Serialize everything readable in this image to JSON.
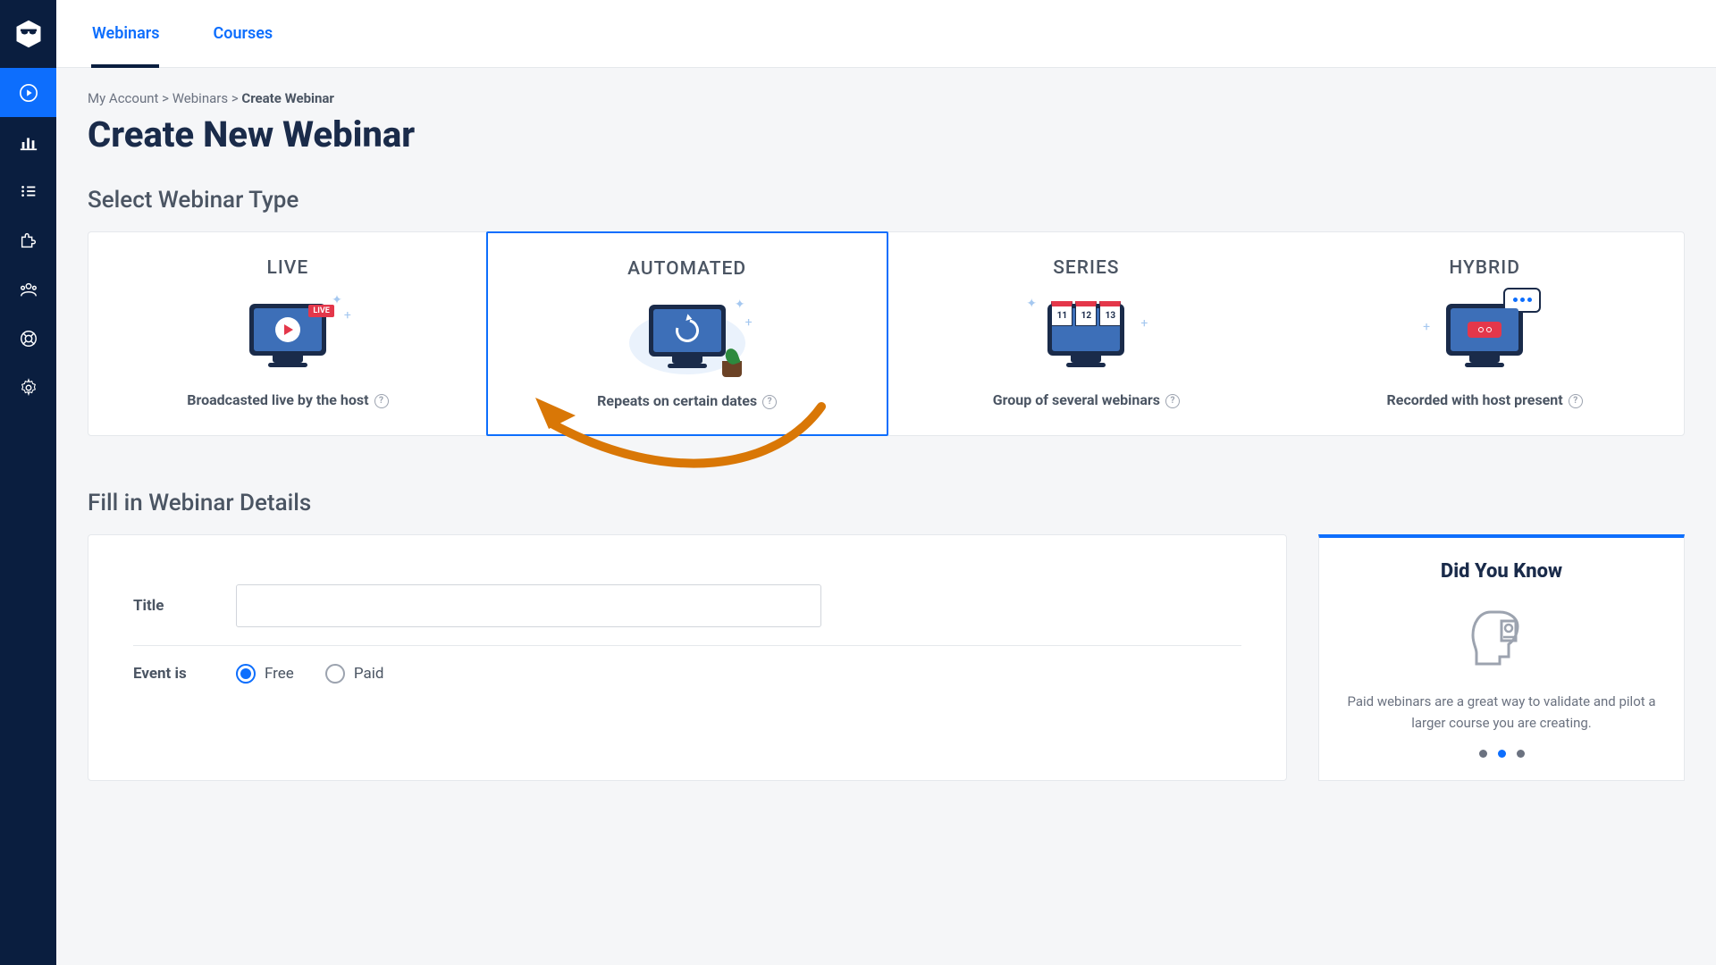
{
  "tabs": {
    "webinars": "Webinars",
    "courses": "Courses"
  },
  "breadcrumb": {
    "l1": "My Account",
    "l2": "Webinars",
    "l3": "Create Webinar",
    "sep": " > "
  },
  "page_title": "Create New Webinar",
  "select_type_heading": "Select Webinar Type",
  "types": {
    "live": {
      "title": "LIVE",
      "desc": "Broadcasted live by the host",
      "badge": "LIVE"
    },
    "automated": {
      "title": "AUTOMATED",
      "desc": "Repeats on certain dates"
    },
    "series": {
      "title": "SERIES",
      "desc": "Group of several webinars",
      "days": [
        "11",
        "12",
        "13"
      ]
    },
    "hybrid": {
      "title": "HYBRID",
      "desc": "Recorded with host present"
    }
  },
  "details_heading": "Fill in Webinar Details",
  "form": {
    "title_label": "Title",
    "event_is_label": "Event is",
    "free": "Free",
    "paid": "Paid"
  },
  "tip": {
    "title": "Did You Know",
    "text": "Paid webinars are a great way to validate and pilot a larger course you are creating."
  },
  "help_glyph": "?"
}
